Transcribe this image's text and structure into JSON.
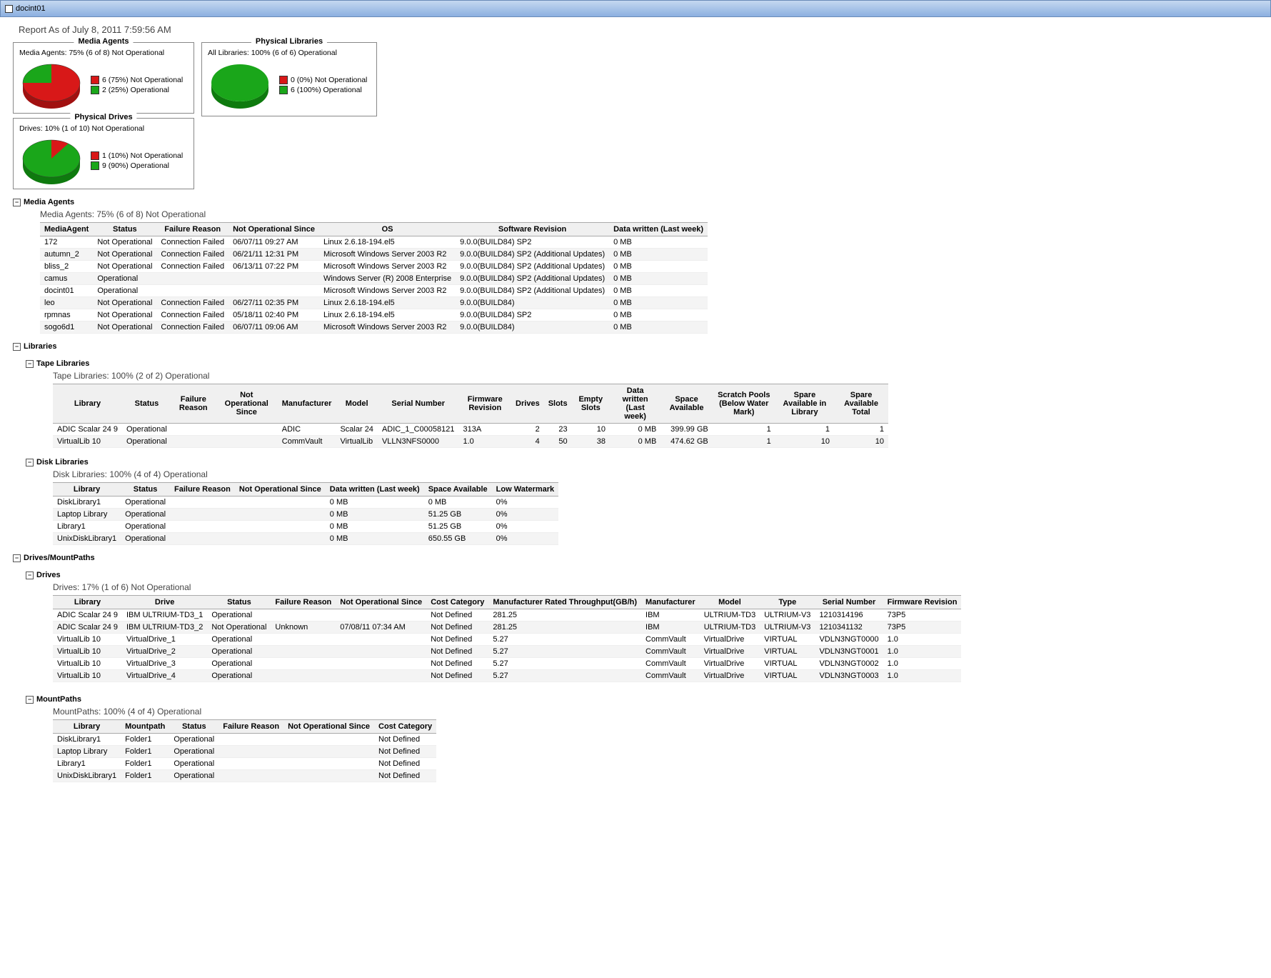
{
  "window_title": "docint01",
  "report_as_of": "Report As of July 8, 2011 7:59:56 AM",
  "colors": {
    "not_operational": "#d81818",
    "operational": "#1aa61a"
  },
  "panels": {
    "media_agents": {
      "title": "Media Agents",
      "sub": "Media Agents: 75% (6 of 8) Not Operational",
      "legend_not": "6 (75%) Not Operational",
      "legend_op": "2 (25%) Operational",
      "frac_not": 0.75
    },
    "physical_libraries": {
      "title": "Physical Libraries",
      "sub": "All Libraries: 100% (6 of 6) Operational",
      "legend_not": "0 (0%) Not Operational",
      "legend_op": "6 (100%) Operational",
      "frac_not": 0.0
    },
    "physical_drives": {
      "title": "Physical Drives",
      "sub": "Drives: 10% (1 of 10) Not Operational",
      "legend_not": "1 (10%) Not Operational",
      "legend_op": "9 (90%) Operational",
      "frac_not": 0.1
    }
  },
  "chart_data": [
    {
      "type": "pie",
      "title": "Media Agents",
      "series": [
        {
          "name": "Not Operational",
          "value": 6
        },
        {
          "name": "Operational",
          "value": 2
        }
      ]
    },
    {
      "type": "pie",
      "title": "Physical Libraries",
      "series": [
        {
          "name": "Not Operational",
          "value": 0
        },
        {
          "name": "Operational",
          "value": 6
        }
      ]
    },
    {
      "type": "pie",
      "title": "Physical Drives",
      "series": [
        {
          "name": "Not Operational",
          "value": 1
        },
        {
          "name": "Operational",
          "value": 9
        }
      ]
    }
  ],
  "sections": {
    "media_agents": {
      "header": "Media Agents",
      "summary": "Media Agents: 75% (6 of 8) Not Operational",
      "columns": [
        "MediaAgent",
        "Status",
        "Failure Reason",
        "Not Operational Since",
        "OS",
        "Software Revision",
        "Data written (Last week)"
      ],
      "rows": [
        [
          "172",
          "Not Operational",
          "Connection Failed",
          "06/07/11 09:27 AM",
          "Linux 2.6.18-194.el5",
          "9.0.0(BUILD84) SP2",
          "0 MB"
        ],
        [
          "autumn_2",
          "Not Operational",
          "Connection Failed",
          "06/21/11 12:31 PM",
          "Microsoft Windows Server 2003 R2",
          "9.0.0(BUILD84) SP2 (Additional Updates)",
          "0 MB"
        ],
        [
          "bliss_2",
          "Not Operational",
          "Connection Failed",
          "06/13/11 07:22 PM",
          "Microsoft Windows Server 2003 R2",
          "9.0.0(BUILD84) SP2 (Additional Updates)",
          "0 MB"
        ],
        [
          "camus",
          "Operational",
          "",
          "",
          "Windows Server (R) 2008 Enterprise",
          "9.0.0(BUILD84) SP2 (Additional Updates)",
          "0 MB"
        ],
        [
          "docint01",
          "Operational",
          "",
          "",
          "Microsoft Windows Server 2003 R2",
          "9.0.0(BUILD84) SP2 (Additional Updates)",
          "0 MB"
        ],
        [
          "leo",
          "Not Operational",
          "Connection Failed",
          "06/27/11 02:35 PM",
          "Linux 2.6.18-194.el5",
          "9.0.0(BUILD84)",
          "0 MB"
        ],
        [
          "rpmnas",
          "Not Operational",
          "Connection Failed",
          "05/18/11 02:40 PM",
          "Linux 2.6.18-194.el5",
          "9.0.0(BUILD84) SP2",
          "0 MB"
        ],
        [
          "sogo6d1",
          "Not Operational",
          "Connection Failed",
          "06/07/11 09:06 AM",
          "Microsoft Windows Server 2003 R2",
          "9.0.0(BUILD84)",
          "0 MB"
        ]
      ]
    },
    "libraries": {
      "header": "Libraries",
      "tape": {
        "header": "Tape Libraries",
        "summary": "Tape Libraries: 100% (2 of 2) Operational",
        "columns": [
          "Library",
          "Status",
          "Failure Reason",
          "Not Operational Since",
          "Manufacturer",
          "Model",
          "Serial Number",
          "Firmware Revision",
          "Drives",
          "Slots",
          "Empty Slots",
          "Data written (Last week)",
          "Space Available",
          "Scratch Pools (Below Water Mark)",
          "Spare Available in Library",
          "Spare Available Total"
        ],
        "rows": [
          [
            "ADIC Scalar 24 9",
            "Operational",
            "",
            "",
            "ADIC",
            "Scalar 24",
            "ADIC_1_C00058121",
            "313A",
            "2",
            "23",
            "10",
            "0 MB",
            "399.99 GB",
            "1",
            "1",
            "1"
          ],
          [
            "VirtualLib 10",
            "Operational",
            "",
            "",
            "CommVault",
            "VirtualLib",
            "VLLN3NFS0000",
            "1.0",
            "4",
            "50",
            "38",
            "0 MB",
            "474.62 GB",
            "1",
            "10",
            "10"
          ]
        ]
      },
      "disk": {
        "header": "Disk Libraries",
        "summary": "Disk Libraries: 100% (4 of 4) Operational",
        "columns": [
          "Library",
          "Status",
          "Failure Reason",
          "Not Operational Since",
          "Data written (Last week)",
          "Space Available",
          "Low Watermark"
        ],
        "rows": [
          [
            "DiskLibrary1",
            "Operational",
            "",
            "",
            "0 MB",
            "0 MB",
            "0%"
          ],
          [
            "Laptop Library",
            "Operational",
            "",
            "",
            "0 MB",
            "51.25 GB",
            "0%"
          ],
          [
            "Library1",
            "Operational",
            "",
            "",
            "0 MB",
            "51.25 GB",
            "0%"
          ],
          [
            "UnixDiskLibrary1",
            "Operational",
            "",
            "",
            "0 MB",
            "650.55 GB",
            "0%"
          ]
        ]
      }
    },
    "drives_mount": {
      "header": "Drives/MountPaths",
      "drives": {
        "header": "Drives",
        "summary": "Drives: 17% (1 of 6) Not Operational",
        "columns": [
          "Library",
          "Drive",
          "Status",
          "Failure Reason",
          "Not Operational Since",
          "Cost Category",
          "Manufacturer Rated Throughput(GB/h)",
          "Manufacturer",
          "Model",
          "Type",
          "Serial Number",
          "Firmware Revision"
        ],
        "rows": [
          [
            "ADIC Scalar 24 9",
            "IBM ULTRIUM-TD3_1",
            "Operational",
            "",
            "",
            "Not Defined",
            "281.25",
            "IBM",
            "ULTRIUM-TD3",
            "ULTRIUM-V3",
            "1210314196",
            "73P5"
          ],
          [
            "ADIC Scalar 24 9",
            "IBM ULTRIUM-TD3_2",
            "Not Operational",
            "Unknown",
            "07/08/11 07:34 AM",
            "Not Defined",
            "281.25",
            "IBM",
            "ULTRIUM-TD3",
            "ULTRIUM-V3",
            "1210341132",
            "73P5"
          ],
          [
            "VirtualLib 10",
            "VirtualDrive_1",
            "Operational",
            "",
            "",
            "Not Defined",
            "5.27",
            "CommVault",
            "VirtualDrive",
            "VIRTUAL",
            "VDLN3NGT0000",
            "1.0"
          ],
          [
            "VirtualLib 10",
            "VirtualDrive_2",
            "Operational",
            "",
            "",
            "Not Defined",
            "5.27",
            "CommVault",
            "VirtualDrive",
            "VIRTUAL",
            "VDLN3NGT0001",
            "1.0"
          ],
          [
            "VirtualLib 10",
            "VirtualDrive_3",
            "Operational",
            "",
            "",
            "Not Defined",
            "5.27",
            "CommVault",
            "VirtualDrive",
            "VIRTUAL",
            "VDLN3NGT0002",
            "1.0"
          ],
          [
            "VirtualLib 10",
            "VirtualDrive_4",
            "Operational",
            "",
            "",
            "Not Defined",
            "5.27",
            "CommVault",
            "VirtualDrive",
            "VIRTUAL",
            "VDLN3NGT0003",
            "1.0"
          ]
        ]
      },
      "mountpaths": {
        "header": "MountPaths",
        "summary": "MountPaths: 100% (4 of 4) Operational",
        "columns": [
          "Library",
          "Mountpath",
          "Status",
          "Failure Reason",
          "Not Operational Since",
          "Cost Category"
        ],
        "rows": [
          [
            "DiskLibrary1",
            "Folder1",
            "Operational",
            "",
            "",
            "Not Defined"
          ],
          [
            "Laptop Library",
            "Folder1",
            "Operational",
            "",
            "",
            "Not Defined"
          ],
          [
            "Library1",
            "Folder1",
            "Operational",
            "",
            "",
            "Not Defined"
          ],
          [
            "UnixDiskLibrary1",
            "Folder1",
            "Operational",
            "",
            "",
            "Not Defined"
          ]
        ]
      }
    }
  }
}
